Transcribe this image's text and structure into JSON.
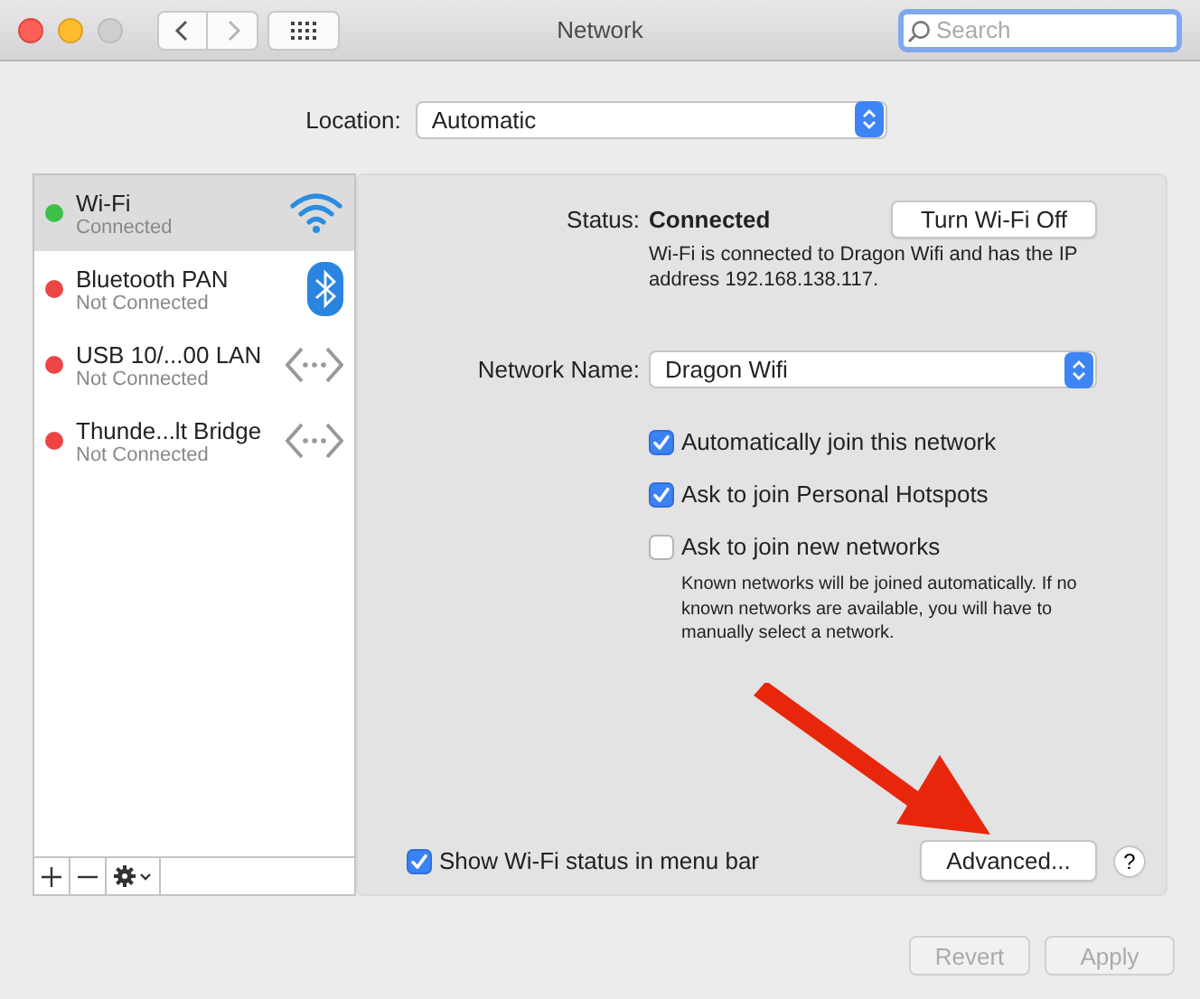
{
  "window": {
    "title": "Network"
  },
  "nav": [
    {
      "kind": "back",
      "disabled": false
    },
    {
      "kind": "forward",
      "disabled": true
    }
  ],
  "search": {
    "placeholder": "Search"
  },
  "location": {
    "label": "Location:",
    "value": "Automatic"
  },
  "services": [
    {
      "name": "Wi-Fi",
      "status": "Connected",
      "color": "#3cc04a",
      "kind": "wifi",
      "selected": true
    },
    {
      "name": "Bluetooth PAN",
      "status": "Not Connected",
      "color": "#ee4444",
      "kind": "bluetooth",
      "selected": false
    },
    {
      "name": "USB 10/...00 LAN",
      "status": "Not Connected",
      "color": "#ee4444",
      "kind": "ethernet",
      "selected": false
    },
    {
      "name": "Thunde...lt Bridge",
      "status": "Not Connected",
      "color": "#ee4444",
      "kind": "ethernet",
      "selected": false
    }
  ],
  "detail": {
    "status_label": "Status:",
    "status_value": "Connected",
    "turn_off_button": "Turn Wi-Fi Off",
    "status_description": "Wi-Fi is connected to Dragon Wifi and has the IP address 192.168.138.117.",
    "network_name_label": "Network Name:",
    "network_name": "Dragon Wifi",
    "options": [
      {
        "label": "Automatically join this network",
        "checked": true
      },
      {
        "label": "Ask to join Personal Hotspots",
        "checked": true
      },
      {
        "label": "Ask to join new networks",
        "checked": false,
        "note": "Known networks will be joined automatically. If no known networks are available, you will have to manually select a network."
      }
    ],
    "show_status": {
      "label": "Show Wi-Fi status in menu bar",
      "checked": true
    },
    "advanced_button": "Advanced...",
    "help_button": "?"
  },
  "footer_buttons": [
    {
      "label": "Revert",
      "disabled": true
    },
    {
      "label": "Apply",
      "disabled": true
    }
  ]
}
